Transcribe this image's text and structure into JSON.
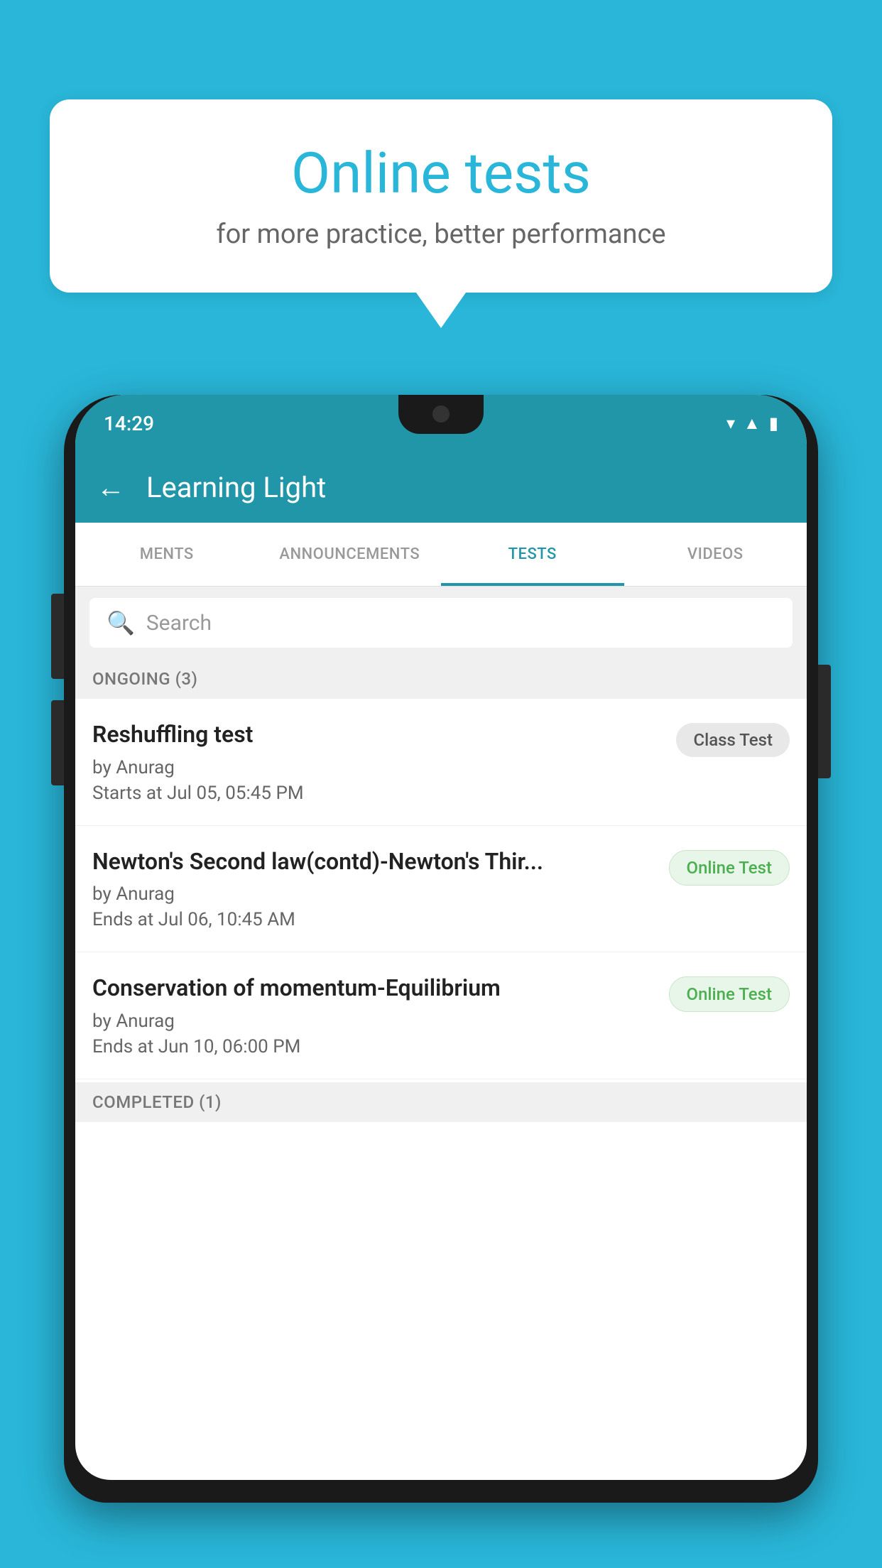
{
  "background_color": "#29B6D8",
  "bubble": {
    "title": "Online tests",
    "subtitle": "for more practice, better performance"
  },
  "phone": {
    "status_bar": {
      "time": "14:29",
      "icons": [
        "▾▾",
        "▲",
        "▮"
      ]
    },
    "header": {
      "back_label": "←",
      "title": "Learning Light"
    },
    "tabs": [
      {
        "label": "MENTS",
        "active": false
      },
      {
        "label": "ANNOUNCEMENTS",
        "active": false
      },
      {
        "label": "TESTS",
        "active": true
      },
      {
        "label": "VIDEOS",
        "active": false
      }
    ],
    "search": {
      "placeholder": "Search"
    },
    "ongoing_section": {
      "label": "ONGOING (3)"
    },
    "tests": [
      {
        "name": "Reshuffling test",
        "author": "by Anurag",
        "time": "Starts at  Jul 05, 05:45 PM",
        "badge": "Class Test",
        "badge_type": "class"
      },
      {
        "name": "Newton's Second law(contd)-Newton's Thir...",
        "author": "by Anurag",
        "time": "Ends at  Jul 06, 10:45 AM",
        "badge": "Online Test",
        "badge_type": "online"
      },
      {
        "name": "Conservation of momentum-Equilibrium",
        "author": "by Anurag",
        "time": "Ends at  Jun 10, 06:00 PM",
        "badge": "Online Test",
        "badge_type": "online"
      }
    ],
    "completed_section": {
      "label": "COMPLETED (1)"
    }
  }
}
